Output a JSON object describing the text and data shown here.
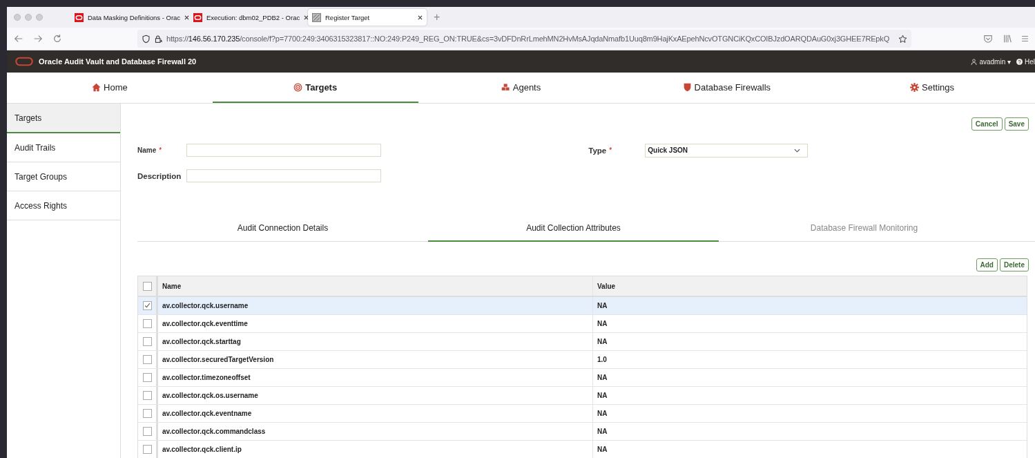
{
  "browser": {
    "tabs": [
      {
        "title": "Data Masking Definitions - Orac",
        "selected": false
      },
      {
        "title": "Execution: dbm02_PDB2 - Orac",
        "selected": false
      },
      {
        "title": "Register Target",
        "selected": true
      }
    ],
    "new_tab": "+",
    "url": {
      "scheme": "https://",
      "host": "146.56.170.235",
      "path": "/console/f?p=7700:249:3406315323817::NO:249:P249_REG_ON:TRUE&cs=3vDFDnRrLmehMN2HvMsAJqdaNmafb1Uuq8m9HajKxAEpehNcvOTGNCiKQxCOIBJzdOARQDAuG0xj3GHEE7REpkQ"
    }
  },
  "app": {
    "title": "Oracle Audit Vault and Database Firewall 20",
    "user": "avadmin ▾",
    "help": "Hel"
  },
  "nav": [
    {
      "label": "Home",
      "selected": false
    },
    {
      "label": "Targets",
      "selected": true
    },
    {
      "label": "Agents",
      "selected": false
    },
    {
      "label": "Database Firewalls",
      "selected": false
    },
    {
      "label": "Settings",
      "selected": false
    }
  ],
  "sidebar": {
    "items": [
      {
        "label": "Targets",
        "selected": true
      },
      {
        "label": "Audit Trails",
        "selected": false
      },
      {
        "label": "Target Groups",
        "selected": false
      },
      {
        "label": "Access Rights",
        "selected": false
      }
    ]
  },
  "form": {
    "buttons": [
      "Cancel",
      "Save"
    ],
    "name": {
      "label": "Name",
      "required": "*"
    },
    "description": {
      "label": "Description"
    },
    "type": {
      "label": "Type",
      "required": "*",
      "value": "Quick JSON"
    }
  },
  "subtabs": [
    {
      "label": "Audit Connection Details",
      "selected": false,
      "disabled": false
    },
    {
      "label": "Audit Collection Attributes",
      "selected": true,
      "disabled": false
    },
    {
      "label": "Database Firewall Monitoring",
      "selected": false,
      "disabled": true
    }
  ],
  "table": {
    "buttons": [
      "Add",
      "Delete"
    ],
    "columns": [
      "Name",
      "Value"
    ],
    "all_checked": false,
    "rows": [
      {
        "name": "av.collector.qck.username",
        "value": "NA",
        "selected": true
      },
      {
        "name": "av.collector.qck.eventtime",
        "value": "NA",
        "selected": false
      },
      {
        "name": "av.collector.qck.starttag",
        "value": "NA",
        "selected": false
      },
      {
        "name": "av.collector.securedTargetVersion",
        "value": "1.0",
        "selected": false
      },
      {
        "name": "av.collector.timezoneoffset",
        "value": "NA",
        "selected": false
      },
      {
        "name": "av.collector.qck.os.username",
        "value": "NA",
        "selected": false
      },
      {
        "name": "av.collector.qck.eventname",
        "value": "NA",
        "selected": false
      },
      {
        "name": "av.collector.qck.commandclass",
        "value": "NA",
        "selected": false
      },
      {
        "name": "av.collector.qck.client.ip",
        "value": "NA",
        "selected": false
      }
    ]
  }
}
